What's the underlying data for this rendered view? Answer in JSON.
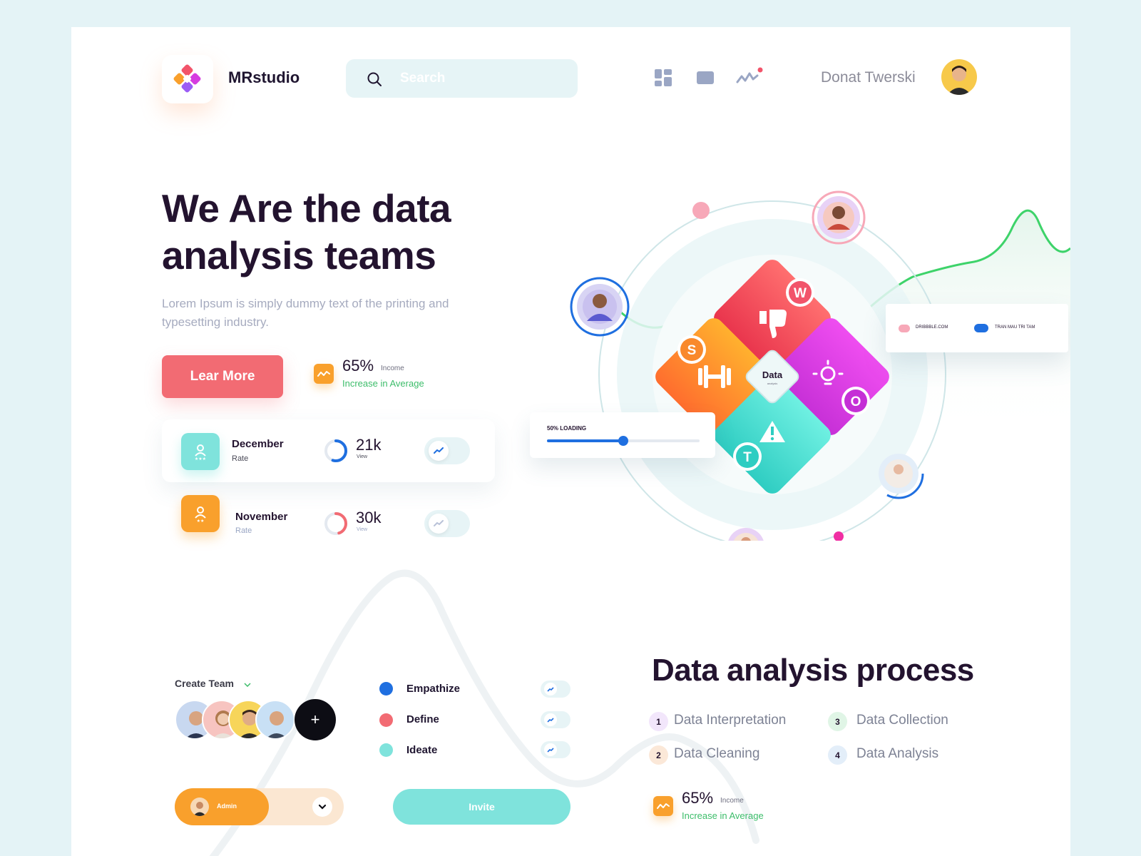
{
  "brand": {
    "name": "MRstudio"
  },
  "search": {
    "placeholder": "Search"
  },
  "header": {
    "icons": [
      "dashboard-icon",
      "card-icon",
      "activity-icon"
    ],
    "user_name": "Donat Twerski"
  },
  "hero": {
    "title": "We Are the data analysis teams",
    "subtitle": "Lorem Ipsum is simply dummy text of the printing and typesetting industry.",
    "cta_label": "Lear More",
    "stat": {
      "value": "65%",
      "unit": "Income",
      "caption": "Increase in Average"
    }
  },
  "rates": [
    {
      "month": "December",
      "label": "Rate",
      "value": "21k",
      "sub": "View",
      "progress": 0.55,
      "accent": "#7fe3dc",
      "ring": "#1f6fe0"
    },
    {
      "month": "November",
      "label": "Rate",
      "value": "30k",
      "sub": "View",
      "progress": 0.45,
      "accent": "#f9a02c",
      "ring": "#f26b73"
    }
  ],
  "illustration": {
    "center_label": "Data",
    "center_sub": "analysis",
    "letters": [
      "W",
      "S",
      "O",
      "T"
    ],
    "loading_label": "50% LOADING",
    "loading_progress": 0.5,
    "legend": [
      {
        "label": "DRIBBBLE.COM",
        "color": "#f7a8b8"
      },
      {
        "label": "TRAN MAU TRI TAM",
        "color": "#1f6fe0"
      }
    ]
  },
  "team": {
    "create_label": "Create Team",
    "add_label": "+",
    "role_label": "Admin",
    "invite_label": "Invite",
    "steps": [
      {
        "label": "Empathize",
        "color": "#1f6fe0"
      },
      {
        "label": "Define",
        "color": "#f26b73"
      },
      {
        "label": "Ideate",
        "color": "#7fe3dc"
      }
    ]
  },
  "process": {
    "title": "Data analysis process",
    "items": [
      {
        "num": "1",
        "label": "Data Interpretation",
        "bg": "#f2e6fb"
      },
      {
        "num": "3",
        "label": "Data Collection",
        "bg": "#e0f5e6"
      },
      {
        "num": "2",
        "label": "Data Cleaning",
        "bg": "#fbe8d8"
      },
      {
        "num": "4",
        "label": "Data Analysis",
        "bg": "#e3eef9"
      }
    ],
    "stat": {
      "value": "65%",
      "unit": "Income",
      "caption": "Increase in Average"
    }
  }
}
